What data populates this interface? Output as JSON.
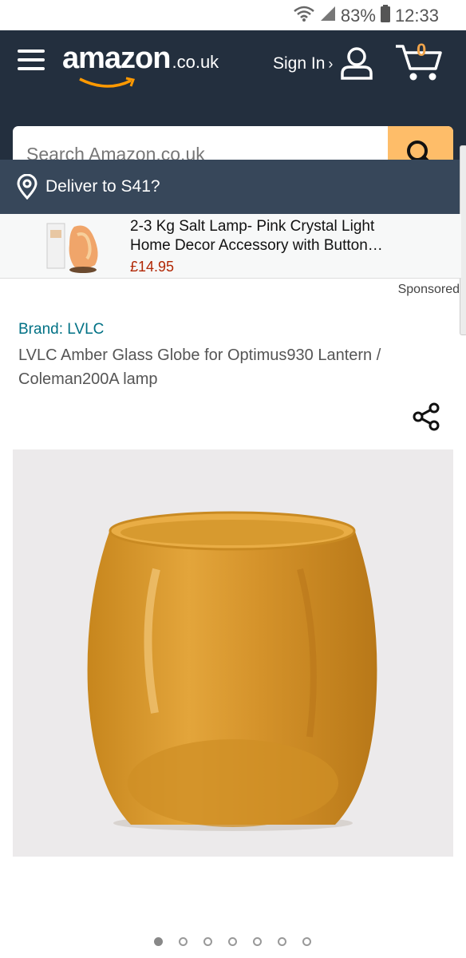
{
  "status_bar": {
    "battery": "83%",
    "time": "12:33"
  },
  "header": {
    "logo_main": "amazon",
    "logo_tld": ".co.uk",
    "sign_in": "Sign In",
    "sign_in_chevron": "›",
    "cart_count": "0",
    "accent": "#febd69",
    "bg": "#232f3e"
  },
  "search": {
    "placeholder": "Search Amazon.co.uk",
    "value": ""
  },
  "deliver": {
    "text": "Deliver to S41?"
  },
  "sponsored_ad": {
    "title": "2-3 Kg Salt Lamp- Pink Crystal Light Home Decor Accessory with Button…",
    "price": "£14.95",
    "label": "Sponsored"
  },
  "product": {
    "brand": "Brand: LVLC",
    "title": "LVLC Amber Glass Globe for Optimus930 Lantern / Coleman200A lamp",
    "image_count": 7,
    "active_image": 1
  }
}
